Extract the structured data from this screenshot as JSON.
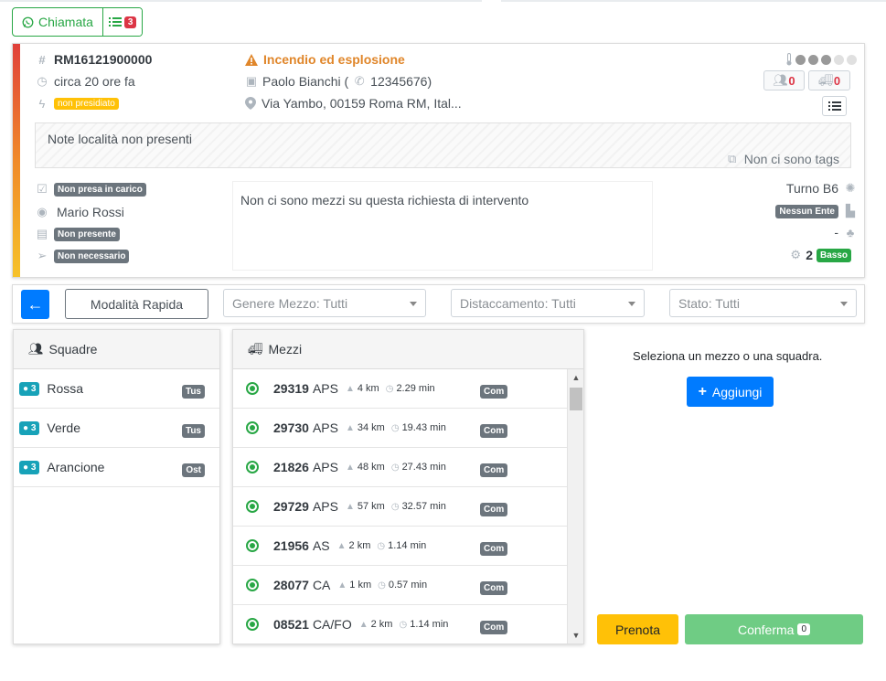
{
  "header": {
    "chiamata_label": "Chiamata",
    "list_badge": "3"
  },
  "richiesta": {
    "code": "RM16121900000",
    "time": "circa 20 ore fa",
    "presidio": "non presidiato",
    "title": "Incendio ed esplosione",
    "richiedente": "Paolo Bianchi (",
    "telefono": "12345676)",
    "indirizzo": "Via Yambo, 00159 Roma RM, Ital...",
    "squadre_count": "0",
    "mezzi_count": "0",
    "priority_dots": 3,
    "note": "Note località non presenti",
    "tags": "Non ci sono tags",
    "stato_carico": "Non presa in carico",
    "operatore": "Mario Rossi",
    "scheda": "Non presente",
    "invio": "Non necessario",
    "mezzi_message": "Non ci sono mezzi su questa richiesta di intervento",
    "turno": "Turno B6",
    "ente": "Nessun Ente",
    "dash": "-",
    "rischio_num": "2",
    "rischio_label": "Basso"
  },
  "filters": {
    "modalita": "Modalità Rapida",
    "genere": "Genere Mezzo: Tutti",
    "distaccamento": "Distaccamento: Tutti",
    "stato": "Stato: Tutti"
  },
  "squadre": {
    "title": "Squadre",
    "items": [
      {
        "count": "3",
        "name": "Rossa",
        "tag": "Tus"
      },
      {
        "count": "3",
        "name": "Verde",
        "tag": "Tus"
      },
      {
        "count": "3",
        "name": "Arancione",
        "tag": "Ost"
      }
    ]
  },
  "mezzi": {
    "title": "Mezzi",
    "items": [
      {
        "code": "29319",
        "type": "APS",
        "km": "4 km",
        "min": "2.29 min",
        "tag": "Com"
      },
      {
        "code": "29730",
        "type": "APS",
        "km": "34 km",
        "min": "19.43 min",
        "tag": "Com"
      },
      {
        "code": "21826",
        "type": "APS",
        "km": "48 km",
        "min": "27.43 min",
        "tag": "Com"
      },
      {
        "code": "29729",
        "type": "APS",
        "km": "57 km",
        "min": "32.57 min",
        "tag": "Com"
      },
      {
        "code": "21956",
        "type": "AS",
        "km": "2 km",
        "min": "1.14 min",
        "tag": "Com"
      },
      {
        "code": "28077",
        "type": "CA",
        "km": "1 km",
        "min": "0.57 min",
        "tag": "Com"
      },
      {
        "code": "08521",
        "type": "CA/FO",
        "km": "2 km",
        "min": "1.14 min",
        "tag": "Com"
      }
    ]
  },
  "actions": {
    "prompt": "Seleziona un mezzo o una squadra.",
    "aggiungi": "Aggiungi",
    "prenota": "Prenota",
    "conferma": "Conferma",
    "conferma_count": "0"
  }
}
